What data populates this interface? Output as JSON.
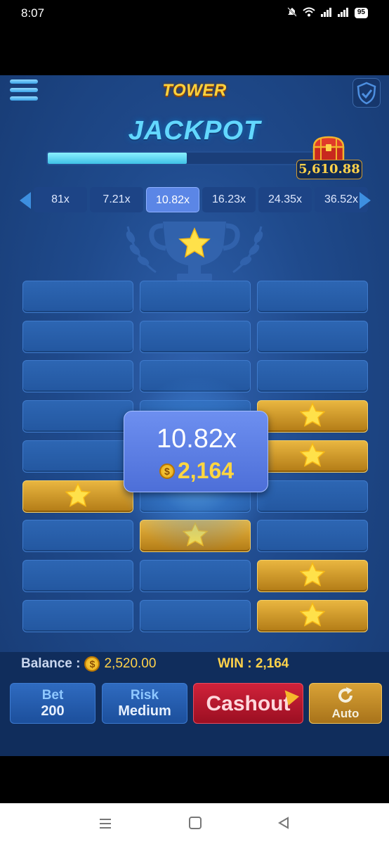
{
  "status_bar": {
    "time": "8:07",
    "battery": "95"
  },
  "header": {
    "title": "TOWER",
    "jackpot_label": "JACKPOT",
    "jackpot_value": "5,610.88",
    "jackpot_progress": 0.5
  },
  "multipliers": [
    "81x",
    "7.21x",
    "10.82x",
    "16.23x",
    "24.35x",
    "36.52x"
  ],
  "active_multiplier": "10.82x",
  "grid": {
    "columns": 3,
    "rows": [
      [
        "blank",
        "blank",
        "blank"
      ],
      [
        "blank",
        "blank",
        "blank"
      ],
      [
        "blank",
        "blank",
        "blank"
      ],
      [
        "blank",
        "blank",
        "star"
      ],
      [
        "blank",
        "blank",
        "star"
      ],
      [
        "star",
        "blank",
        "blank"
      ],
      [
        "blank",
        "star",
        "blank"
      ],
      [
        "blank",
        "blank",
        "star"
      ],
      [
        "blank",
        "blank",
        "star"
      ]
    ]
  },
  "popup": {
    "multiplier": "10.82x",
    "coin_symbol": "$",
    "win": "2,164"
  },
  "footer": {
    "balance_label": "Balance :",
    "coin_symbol": "$",
    "balance_value": "2,520.00",
    "win_text": "WIN : 2,164",
    "bet_label": "Bet",
    "bet_value": "200",
    "risk_label": "Risk",
    "risk_value": "Medium",
    "cashout_label": "Cashout",
    "auto_label": "Auto"
  },
  "colors": {
    "accent_gold": "#e9b640",
    "tile_blue": "#2d66b3",
    "cashout_red": "#d0223a"
  }
}
